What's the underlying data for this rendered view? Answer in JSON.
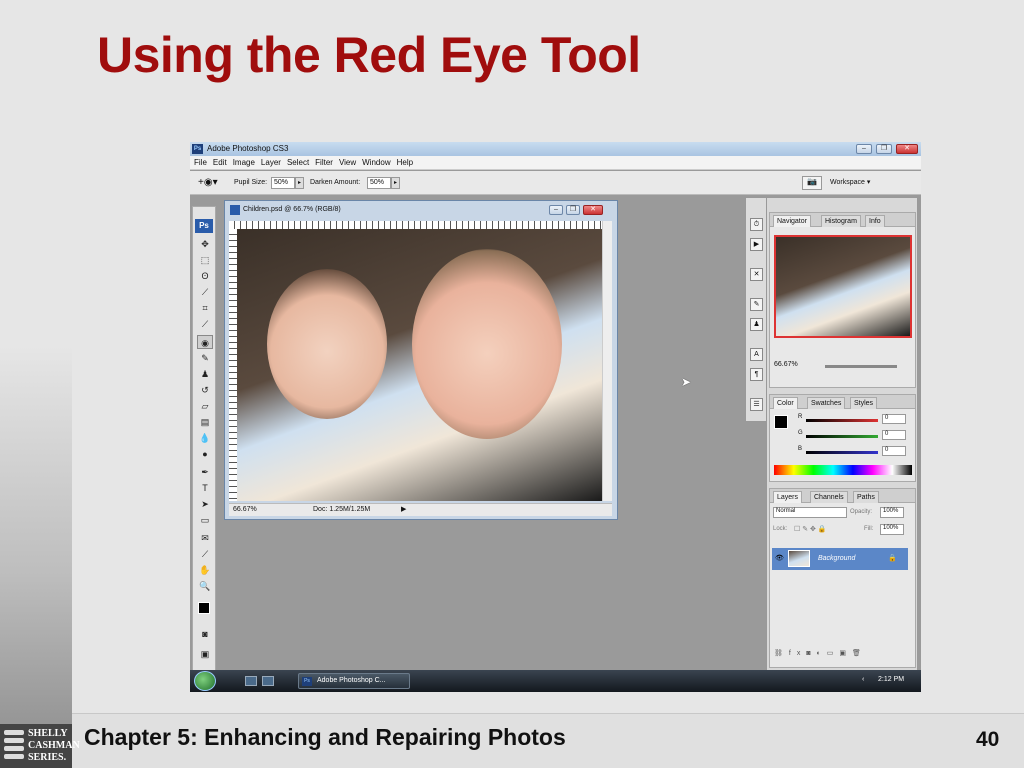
{
  "slide": {
    "title": "Using the Red Eye Tool",
    "footer": "Chapter 5: Enhancing and Repairing Photos",
    "page_number": "40",
    "logo_lines": [
      "SHELLY",
      "CASHMAN",
      "SERIES."
    ],
    "title_color": "#a00d0d"
  },
  "app": {
    "window_title": "Adobe Photoshop CS3",
    "logo_text": "Ps",
    "menus": [
      "File",
      "Edit",
      "Image",
      "Layer",
      "Select",
      "Filter",
      "View",
      "Window",
      "Help"
    ],
    "options": {
      "pupil_size_label": "Pupil Size:",
      "pupil_size_value": "50%",
      "darken_amount_label": "Darken Amount:",
      "darken_amount_value": "50%",
      "workspace_label": "Workspace"
    },
    "toolbox_badge": "Ps",
    "document": {
      "title": "Children.psd @ 66.7% (RGB/8)",
      "zoom": "66.67%",
      "doc_info": "Doc: 1.25M/1.25M"
    },
    "navigator": {
      "tabs": [
        "Navigator",
        "Histogram",
        "Info"
      ],
      "zoom": "66.67%"
    },
    "color": {
      "tabs": [
        "Color",
        "Swatches",
        "Styles"
      ],
      "channels": [
        {
          "label": "R",
          "value": "0",
          "color": "#d33"
        },
        {
          "label": "G",
          "value": "0",
          "color": "#3a3"
        },
        {
          "label": "B",
          "value": "0",
          "color": "#33c"
        }
      ]
    },
    "layers": {
      "tabs": [
        "Layers",
        "Channels",
        "Paths"
      ],
      "blend_mode": "Normal",
      "opacity_label": "Opacity:",
      "opacity_value": "100%",
      "lock_label": "Lock:",
      "fill_label": "Fill:",
      "fill_value": "100%",
      "layer_name": "Background"
    },
    "taskbar": {
      "task_label": "Adobe Photoshop C...",
      "clock": "2:12 PM"
    }
  }
}
